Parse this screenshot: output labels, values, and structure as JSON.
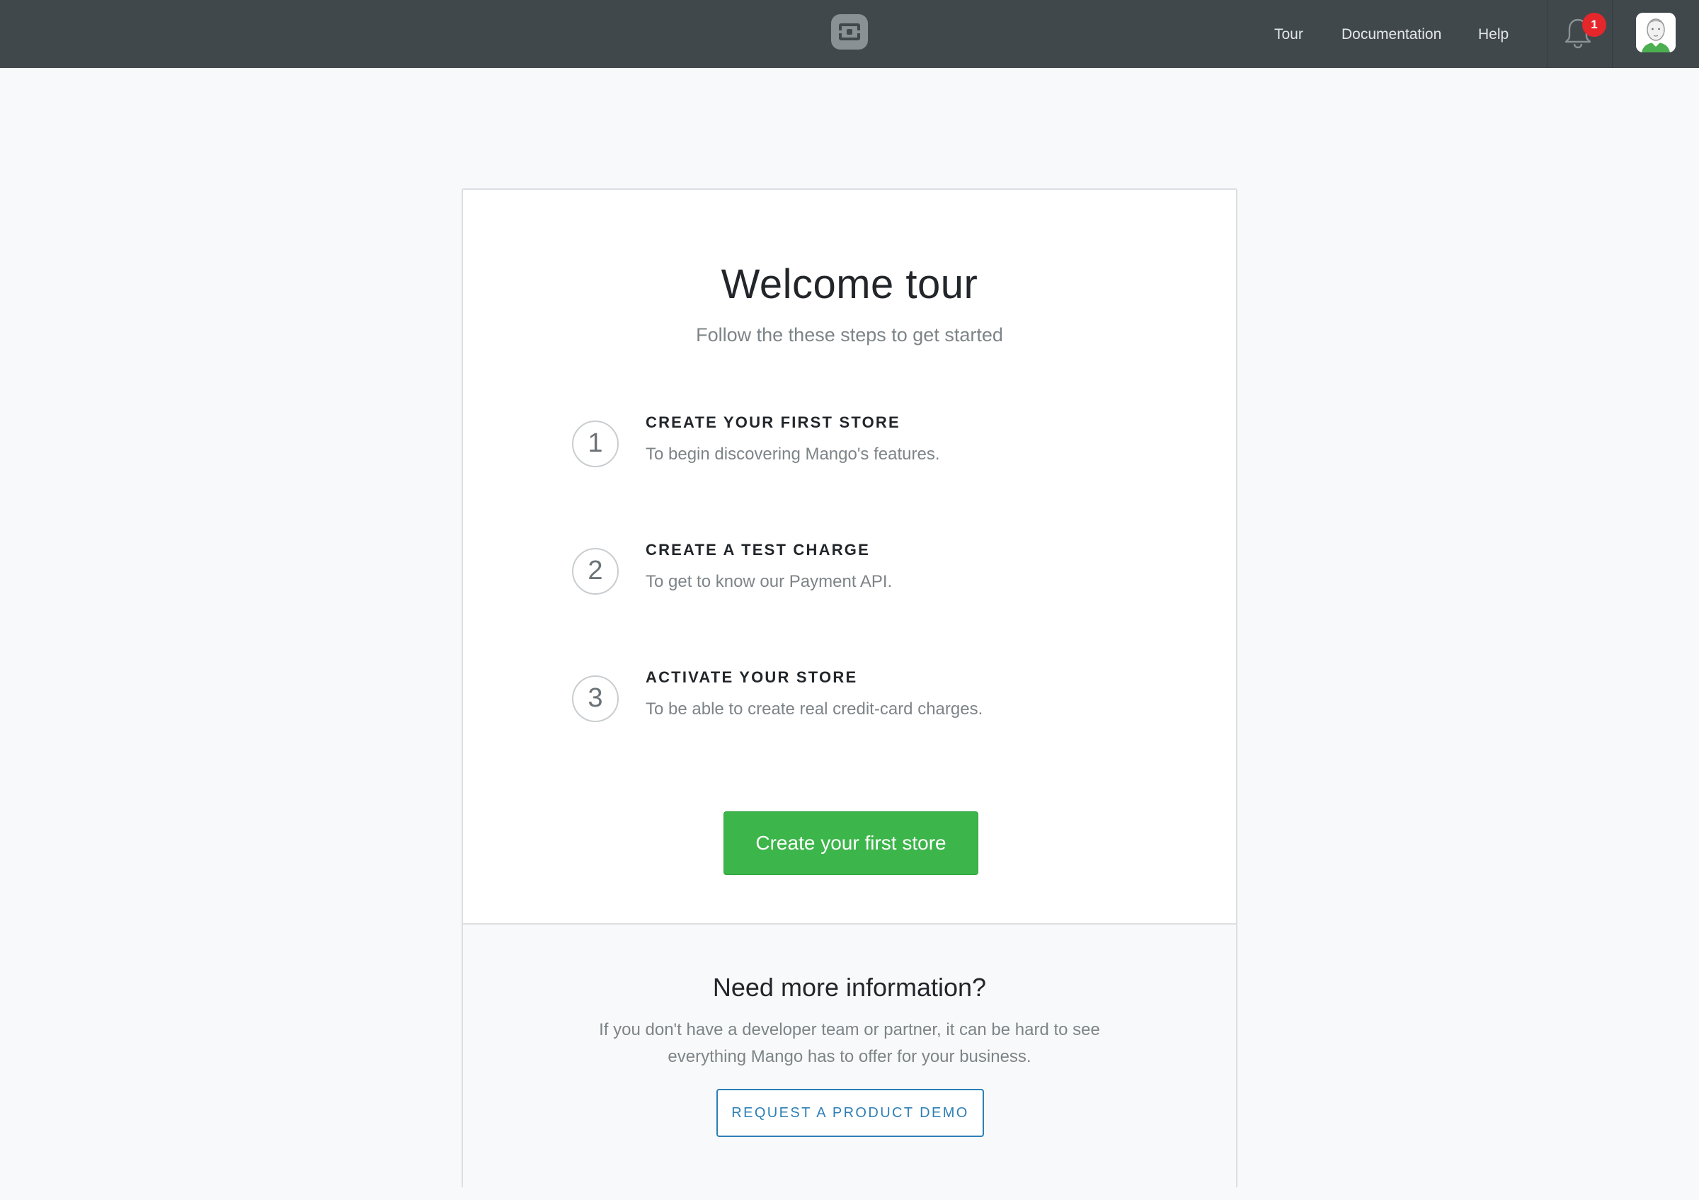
{
  "header": {
    "nav": [
      {
        "label": "Tour"
      },
      {
        "label": "Documentation"
      },
      {
        "label": "Help"
      }
    ],
    "notifications": {
      "count": "1",
      "icon": "bell-icon"
    },
    "avatar": {
      "icon": "user-avatar"
    },
    "colors": {
      "background": "#40484c",
      "badge": "#e5262b"
    }
  },
  "main": {
    "title": "Welcome tour",
    "subtitle": "Follow the these steps to get started",
    "steps": [
      {
        "number": "1",
        "title": "CREATE YOUR FIRST STORE",
        "description": "To begin discovering Mango's features."
      },
      {
        "number": "2",
        "title": "CREATE A TEST CHARGE",
        "description": "To get to know our Payment API."
      },
      {
        "number": "3",
        "title": "ACTIVATE YOUR STORE",
        "description": "To be able to create real credit-card charges."
      }
    ],
    "primary_button": "Create your first store",
    "colors": {
      "primary": "#3cb54a"
    }
  },
  "footer": {
    "title": "Need more information?",
    "text": "If you don't have a developer team or partner, it can be hard to see everything Mango has to offer for your business.",
    "button": "REQUEST A PRODUCT DEMO",
    "colors": {
      "link": "#2d7fb6"
    }
  }
}
